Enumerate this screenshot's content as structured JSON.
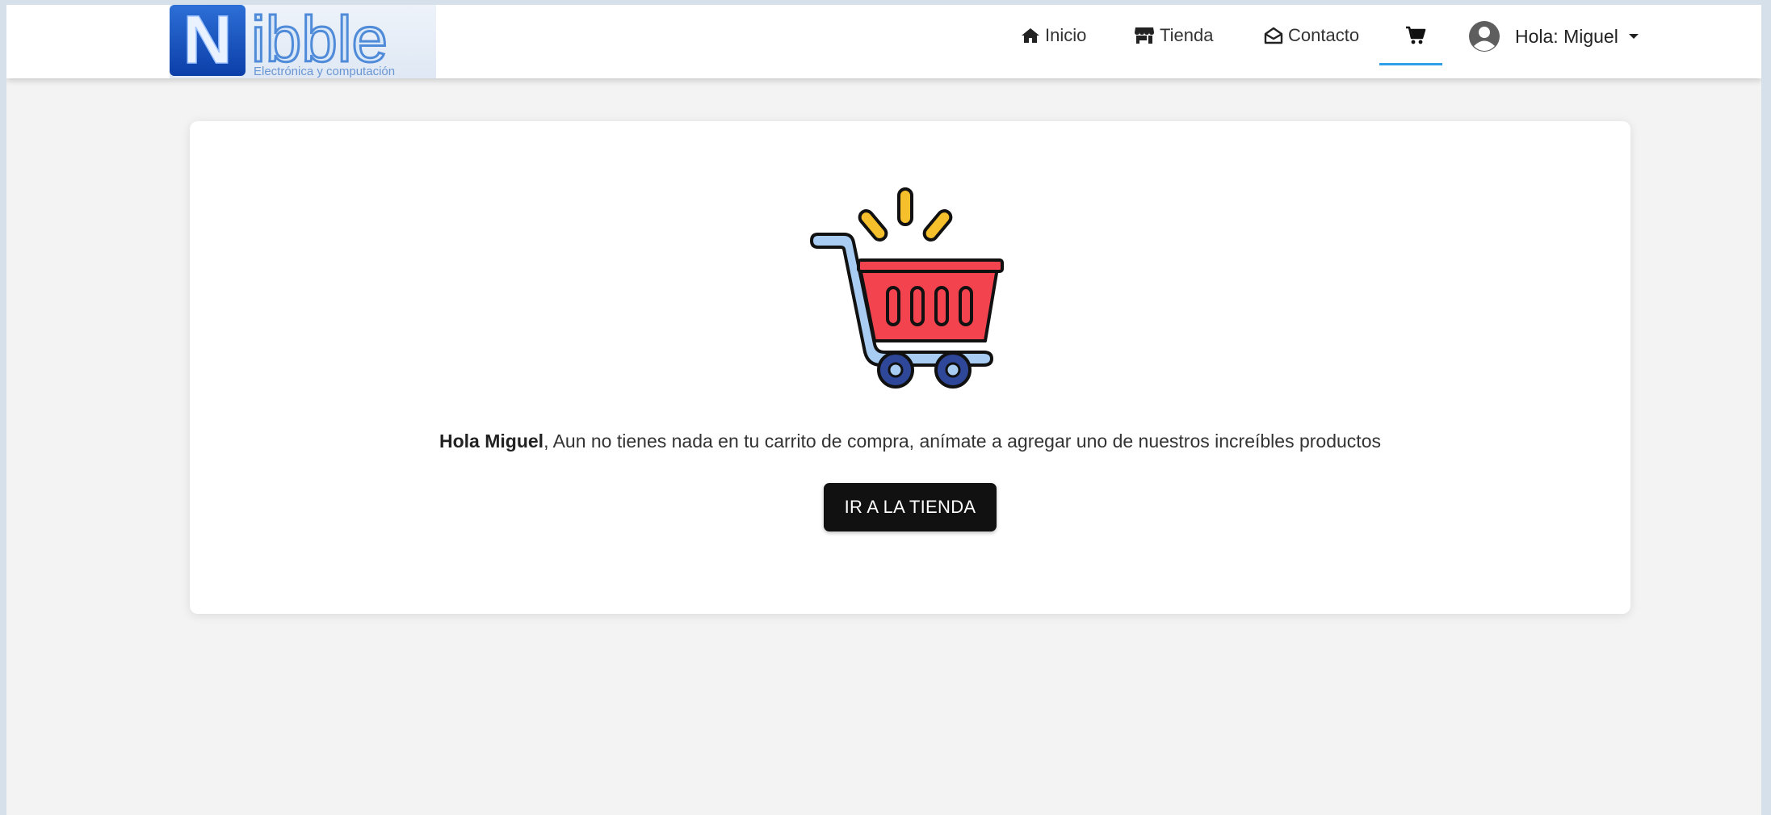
{
  "brand": {
    "logo_text": "Nibble",
    "logo_tagline": "Electrónica y computación"
  },
  "nav": {
    "items": [
      {
        "label": "Inicio",
        "icon": "home-icon"
      },
      {
        "label": "Tienda",
        "icon": "store-icon"
      },
      {
        "label": "Contacto",
        "icon": "envelope-open-icon"
      }
    ],
    "cart_icon": "cart-icon",
    "active_item": "cart",
    "user_greeting": "Hola: Miguel"
  },
  "empty_cart": {
    "user_name": "Hola Miguel",
    "message": ", Aun no tienes nada en tu carrito de compra, anímate a agregar uno de nuestros increíbles productos",
    "button_label": "IR A LA TIENDA"
  },
  "colors": {
    "accent_underline": "#2f9ee8",
    "button_background": "#111111",
    "cart_basket": "#f2434f",
    "cart_wheels": "#2e4799",
    "cart_sparkles": "#f6c02c"
  }
}
